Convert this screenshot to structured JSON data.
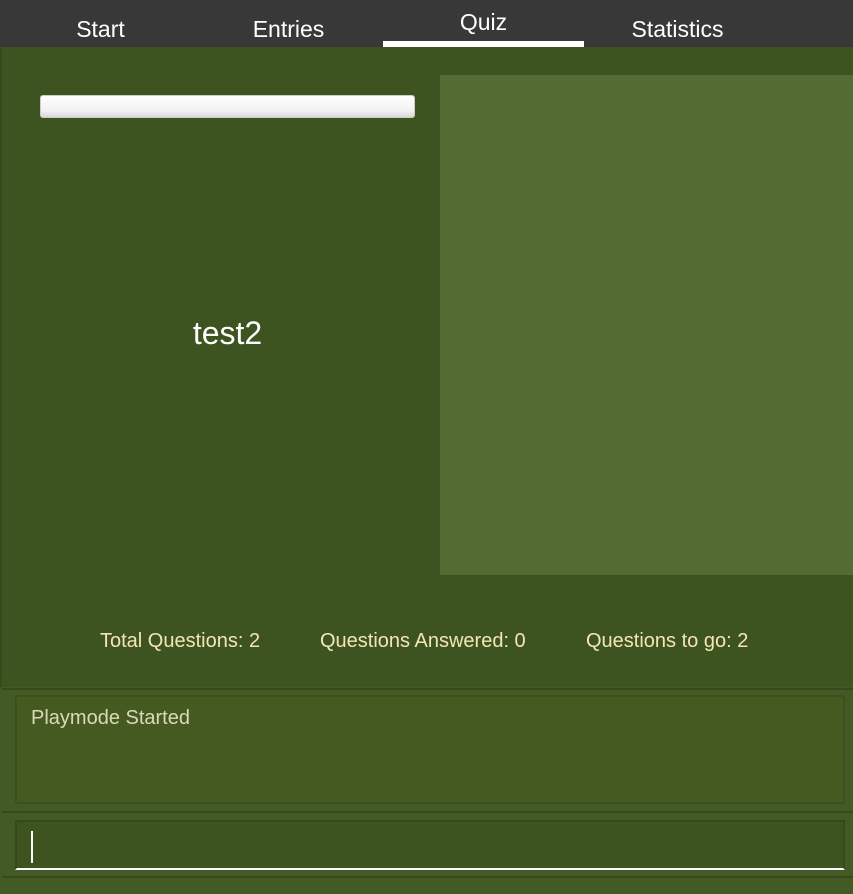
{
  "tabs": [
    {
      "label": "Start"
    },
    {
      "label": "Entries"
    },
    {
      "label": "Quiz",
      "active": true
    },
    {
      "label": "Statistics"
    }
  ],
  "quiz": {
    "question": "test2",
    "progress": 0,
    "stats": {
      "total": "Total Questions: 2",
      "answered": "Questions Answered: 0",
      "to_go": "Questions to go: 2"
    }
  },
  "log": {
    "message": "Playmode Started"
  },
  "command_input": {
    "value": ""
  }
}
